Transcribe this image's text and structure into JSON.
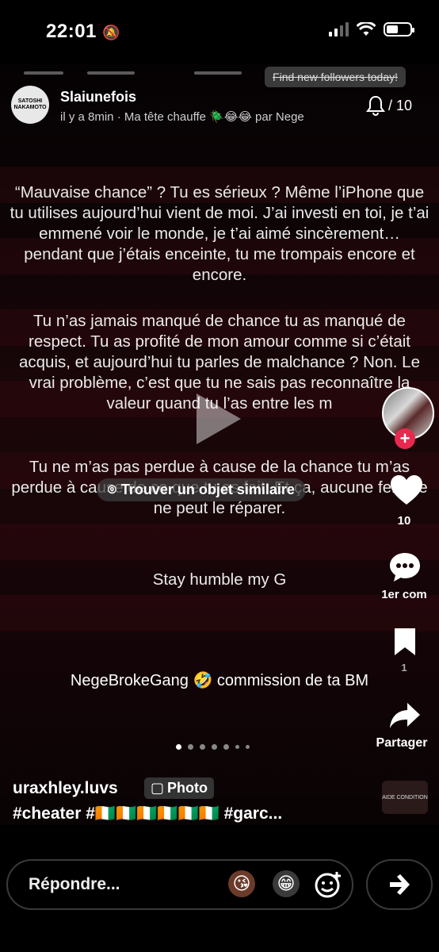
{
  "status": {
    "time": "22:01"
  },
  "header": {
    "find_followers": "Find new followers today!",
    "username": "Slaiunefois",
    "subline": "il y a 8min · Ma tête chauffe 🪲😂😂 par Nege",
    "avatar_text": "SATOSHI NAKAMOTO",
    "notifications": "/ 10"
  },
  "story": {
    "paragraphs": [
      "“Mauvaise chance” ? Tu es sérieux ? Même l’iPhone que tu utilises aujourd’hui vient de moi. J’ai investi en toi, je t’ai emmené voir le monde, je t’ai aimé sincèrement… pendant que j’étais enceinte, tu me trompais encore et encore.",
      "Tu n’as jamais manqué de chance tu as manqué de respect. Tu as profité de mon amour comme si c’était acquis, et aujourd’hui tu parles de malchance ? Non. Le vrai problème, c’est que tu ne sais pas reconnaître la valeur quand tu l’as entre les m",
      "Tu ne m’as pas perdue à cause de la chance tu m’as perdue à cause de ce que tu as fait. Et ça, aucune femme ne peut le réparer.",
      "Stay humble my G"
    ],
    "find_similar": "Trouver un objet similaire",
    "caption": "NegeBrokeGang 🤣 commission de ta BM"
  },
  "side": {
    "likes": "10",
    "comments": "1er com",
    "saves": "1",
    "share": "Partager"
  },
  "post": {
    "user": "uraxhley.luvs",
    "badge": "Photo",
    "tags": "#cheater #🇨🇮🇨🇮🇨🇮🇨🇮🇨🇮🇨🇮 #garc...",
    "thumb_text": "AIDE CONDITION"
  },
  "reply": {
    "placeholder": "Répondre..."
  }
}
